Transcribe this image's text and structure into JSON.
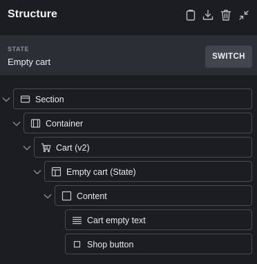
{
  "panel": {
    "title": "Structure",
    "actions": [
      {
        "name": "clipboard-icon"
      },
      {
        "name": "download-icon"
      },
      {
        "name": "trash-icon"
      },
      {
        "name": "collapse-icon"
      }
    ]
  },
  "state": {
    "label": "STATE",
    "value": "Empty cart",
    "switch_label": "SWITCH"
  },
  "tree": {
    "nodes": [
      {
        "label": "Section",
        "icon": "section-icon",
        "expandable": true
      },
      {
        "label": "Container",
        "icon": "container-icon",
        "expandable": true
      },
      {
        "label": "Cart (v2)",
        "icon": "cart-icon",
        "expandable": true
      },
      {
        "label": "Empty cart (State)",
        "icon": "layout-icon",
        "expandable": true
      },
      {
        "label": "Content",
        "icon": "box-icon",
        "expandable": true
      },
      {
        "label": "Cart empty text",
        "icon": "text-lines-icon",
        "expandable": false
      },
      {
        "label": "Shop button",
        "icon": "button-icon",
        "expandable": false
      }
    ]
  },
  "colors": {
    "background": "#1c1d21",
    "state_bar": "#2b2e35",
    "button": "#41454e",
    "border": "#474b54"
  }
}
